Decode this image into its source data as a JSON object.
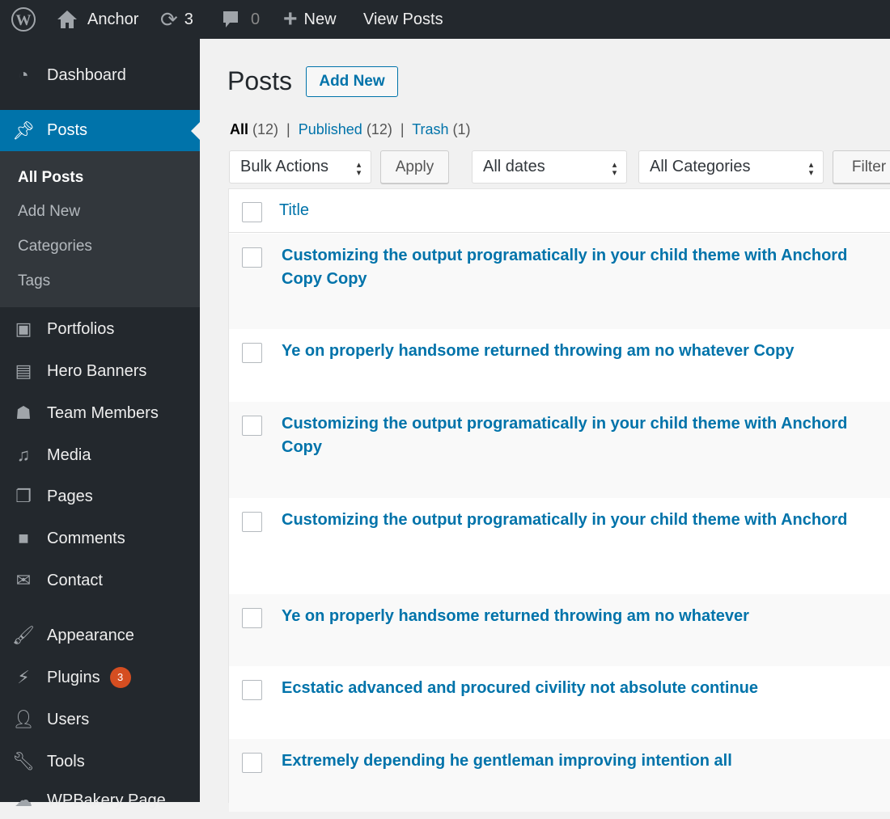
{
  "admin_bar": {
    "site": "Anchor",
    "updates": "3",
    "comments": "0",
    "new": "New",
    "view": "View Posts"
  },
  "sidebar": {
    "items": [
      {
        "label": "Dashboard",
        "icon": "dashboard-icon"
      },
      {
        "label": "Posts",
        "icon": "pin-icon"
      },
      {
        "label": "Portfolios",
        "icon": "portfolio-icon"
      },
      {
        "label": "Hero Banners",
        "icon": "banner-icon"
      },
      {
        "label": "Team Members",
        "icon": "team-icon"
      },
      {
        "label": "Media",
        "icon": "media-icon"
      },
      {
        "label": "Pages",
        "icon": "pages-icon"
      },
      {
        "label": "Comments",
        "icon": "comment-icon"
      },
      {
        "label": "Contact",
        "icon": "mail-icon"
      },
      {
        "label": "Appearance",
        "icon": "brush-icon"
      },
      {
        "label": "Plugins",
        "icon": "plugin-icon",
        "badge": "3"
      },
      {
        "label": "Users",
        "icon": "user-icon"
      },
      {
        "label": "Tools",
        "icon": "wrench-icon"
      },
      {
        "label": "WPBakery Page",
        "icon": "cloud-icon"
      }
    ],
    "submenu": [
      "All Posts",
      "Add New",
      "Categories",
      "Tags"
    ]
  },
  "page": {
    "title": "Posts",
    "add_new": "Add New",
    "views": {
      "all": "All",
      "all_count": "(12)",
      "published": "Published",
      "published_count": "(12)",
      "trash": "Trash",
      "trash_count": "(1)"
    },
    "bulk": "Bulk Actions",
    "apply": "Apply",
    "dates": "All dates",
    "categories": "All Categories",
    "filter": "Filter",
    "column_title": "Title",
    "posts": [
      "Customizing the output programatically in your child theme with Anchord Copy Copy",
      "Ye on properly handsome returned throwing am no whatever Copy",
      "Customizing the output programatically in your child theme with Anchord Copy",
      "Customizing the output programatically in your child theme with Anchord",
      "Ye on properly handsome returned throwing am no whatever",
      "Ecstatic advanced and procured civility not absolute continue",
      "Extremely depending he gentleman improving intention all"
    ]
  },
  "colors": {
    "accent": "#0073aa",
    "sidebar": "#23282d",
    "badge": "#d54e21"
  }
}
